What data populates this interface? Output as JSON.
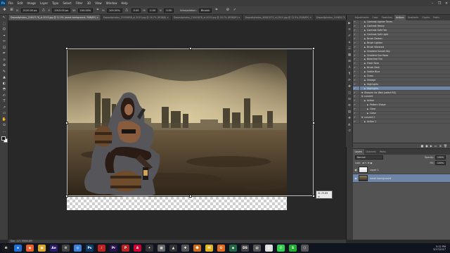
{
  "app": {
    "name": "Ps",
    "menu": [
      "File",
      "Edit",
      "Image",
      "Layer",
      "Type",
      "Select",
      "Filter",
      "3D",
      "View",
      "Window",
      "Help"
    ],
    "window_controls": [
      "–",
      "❐",
      "✕"
    ]
  },
  "options": {
    "x_value": "2120.00 px",
    "y_value": "1915.00 px",
    "w_value": "100.00%",
    "h_value": "100.00%",
    "angle_value": "0.00",
    "h_skew": "0.00",
    "v_skew": "0.00",
    "interpolation_label": "Interpolation:",
    "interpolation_value": "Bicubic"
  },
  "tabs": [
    {
      "label": "Depositphotos_22847178_xl-2015.jpg @ 12.5% (mask background, RGB/8*) ×",
      "active": true
    },
    {
      "label": "Depositphotos_22956658_xl-2015.jpg @ 16.7% (RGB/8) ×",
      "active": false
    },
    {
      "label": "Depositphotos_23045876_xl-2015.jpg @ 16.7% (RGB/8*) ×",
      "active": false
    },
    {
      "label": "Depositphotos_40081573_xl-2015.jpg @ 12.5% (RGB/8*) ×",
      "active": false
    },
    {
      "label": "Depositphotos_14985172_xl-2015.jpg @ 25% (RGB/8*) ×",
      "active": false
    }
  ],
  "tools": [
    "↖",
    "⬚",
    "ʘ",
    "⌖",
    "✂",
    "⊡",
    "✒",
    "⌂",
    "⊕",
    "✎",
    "▲",
    "◐",
    "◓",
    "✍",
    "T",
    "↗",
    "▭",
    "✋",
    "⊙",
    "…"
  ],
  "transform_readout": {
    "w": "W:  25.89 in",
    "h": "H:  15.86 in"
  },
  "status": "Doc: 117.7M/64.8M",
  "panel": {
    "tabs": [
      "Adjustments",
      "Color",
      "Swatches",
      "Actions",
      "Gradients",
      "Glyphs",
      "Paths"
    ],
    "active_tab": "Actions",
    "dock_icons": [
      "▶",
      "≡",
      "✐",
      "⌗",
      "☰",
      "▦",
      "⊞",
      "A",
      "¶",
      "⟳",
      "✚",
      "◫",
      "⊟",
      "⚙",
      "▤",
      "❖",
      "◭",
      "↺"
    ],
    "actions": [
      {
        "label": "Contrast Lighter Tones",
        "indent": 1,
        "selected": false
      },
      {
        "label": "Contrast Heavy",
        "indent": 1,
        "selected": false
      },
      {
        "label": "Contrast Soft Flat",
        "indent": 1,
        "selected": false
      },
      {
        "label": "Contrast Soft Light",
        "indent": 1,
        "selected": false
      },
      {
        "label": "Brush Darken",
        "indent": 1,
        "selected": false
      },
      {
        "label": "Brush Lighten",
        "indent": 1,
        "selected": false
      },
      {
        "label": "Brush Vibrance",
        "indent": 1,
        "selected": false
      },
      {
        "label": "Gradient Sunset Sky",
        "indent": 1,
        "selected": false
      },
      {
        "label": "Gradient Sun Haze",
        "indent": 1,
        "selected": false
      },
      {
        "label": "Bleached Tint",
        "indent": 1,
        "selected": false
      },
      {
        "label": "Fresh Tone",
        "indent": 1,
        "selected": false
      },
      {
        "label": "Brush Dark",
        "indent": 1,
        "selected": false
      },
      {
        "label": "Subtle Blue",
        "indent": 1,
        "selected": false
      },
      {
        "label": "Cross",
        "indent": 1,
        "selected": false
      },
      {
        "label": "Vintage",
        "indent": 1,
        "selected": false
      },
      {
        "label": "Highlights",
        "indent": 1,
        "selected": false
      },
      {
        "label": "Highlights",
        "indent": 1,
        "selected": true
      },
      {
        "label": "Sharpen for Web (select RG)",
        "indent": 0,
        "selected": false
      },
      {
        "label": "convert",
        "indent": 0,
        "selected": false
      },
      {
        "label": "Action",
        "indent": 1,
        "selected": false
      },
      {
        "label": "Pattern Shape",
        "indent": 2,
        "selected": false
      },
      {
        "label": "Clear",
        "indent": 2,
        "selected": false
      },
      {
        "label": "Close",
        "indent": 2,
        "selected": false
      },
      {
        "label": "convert 2",
        "indent": 0,
        "selected": false
      },
      {
        "label": "Action 1",
        "indent": 1,
        "selected": false
      }
    ],
    "action_buttons": [
      "■",
      "●",
      "▶",
      "▭",
      "⊞",
      "🗑"
    ]
  },
  "layers": {
    "tabs": [
      "Layers",
      "Channels",
      "Paths"
    ],
    "blend_mode": "Normal",
    "opacity_label": "Opacity:",
    "opacity_value": "100%",
    "fill_label": "Fill:",
    "fill_value": "100%",
    "lock_label": "Lock:",
    "items": [
      {
        "name": "Layer 1",
        "selected": false
      },
      {
        "name": "mask background",
        "selected": true
      }
    ]
  },
  "taskbar": {
    "apps": [
      {
        "label": "⊞",
        "color": "#1b1b1b"
      },
      {
        "label": "e",
        "color": "#1f6fd1"
      },
      {
        "label": "◉",
        "color": "#e8612b"
      },
      {
        "label": "▣",
        "color": "#d8a42c"
      },
      {
        "label": "Ae",
        "color": "#2b1d6b"
      },
      {
        "label": "⚙",
        "color": "#444"
      },
      {
        "label": "◎",
        "color": "#3f7fd6"
      },
      {
        "label": "Ps",
        "color": "#0d3d67"
      },
      {
        "label": "♪",
        "color": "#bb2222"
      },
      {
        "label": "Pr",
        "color": "#2a1550"
      },
      {
        "label": "P",
        "color": "#b22"
      },
      {
        "label": "A",
        "color": "#c03"
      },
      {
        "label": "✦",
        "color": "#333"
      },
      {
        "label": "▦",
        "color": "#666"
      },
      {
        "label": "▲",
        "color": "#333"
      },
      {
        "label": "✚",
        "color": "#555"
      },
      {
        "label": "☻",
        "color": "#c96a1a"
      },
      {
        "label": "M",
        "color": "#e2b21c"
      },
      {
        "label": "✪",
        "color": "#e06a1e"
      },
      {
        "label": "◆",
        "color": "#264"
      },
      {
        "label": "DS",
        "color": "#444"
      },
      {
        "label": "▤",
        "color": "#555"
      },
      {
        "label": "◐",
        "color": "#ddd"
      },
      {
        "label": "✆",
        "color": "#3c5"
      },
      {
        "label": "S",
        "color": "#2a3"
      },
      {
        "label": "⬡",
        "color": "#555"
      }
    ],
    "time": "5:12 PM",
    "date": "3/17/2017"
  }
}
